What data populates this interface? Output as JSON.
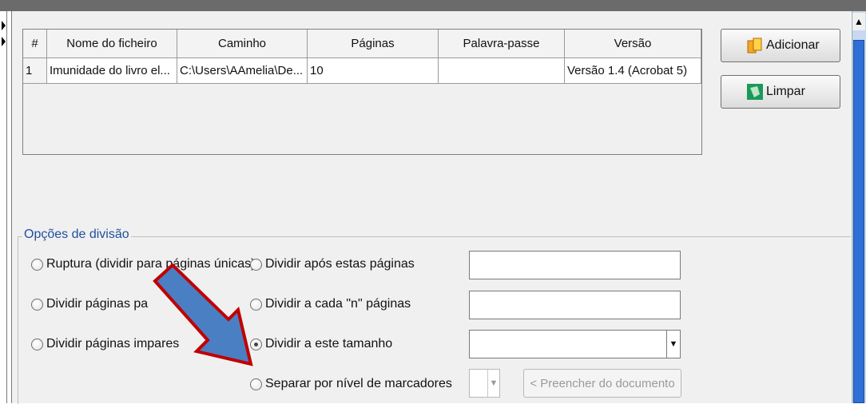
{
  "table": {
    "headers": [
      "#",
      "Nome do ficheiro",
      "Caminho",
      "Páginas",
      "Palavra-passe",
      "Versão"
    ],
    "rows": [
      [
        "1",
        "Imunidade do livro el...",
        "C:\\Users\\AAmelia\\De...",
        "10",
        "",
        "Versão 1.4 (Acrobat 5)"
      ]
    ]
  },
  "buttons": {
    "add_label": "Adicionar",
    "clear_label": "Limpar"
  },
  "split_options": {
    "title": "Opções de divisão",
    "burst": "Ruptura (dividir para páginas únicas)",
    "even": "Dividir páginas pa",
    "odd": "Dividir páginas impares",
    "after_pages": "Dividir após estas páginas",
    "every_n": "Dividir a cada \"n\" páginas",
    "by_size": "Dividir a este tamanho",
    "by_bookmark": "Separar por nível de marcadores",
    "selected": "by_size",
    "fill_from_doc": "< Preencher do documento",
    "after_pages_value": "",
    "every_n_value": "",
    "size_value": ""
  },
  "colors": {
    "group_title": "#1f4f9e",
    "arrow_fill": "#4a7fc4",
    "arrow_stroke": "#c00000"
  }
}
